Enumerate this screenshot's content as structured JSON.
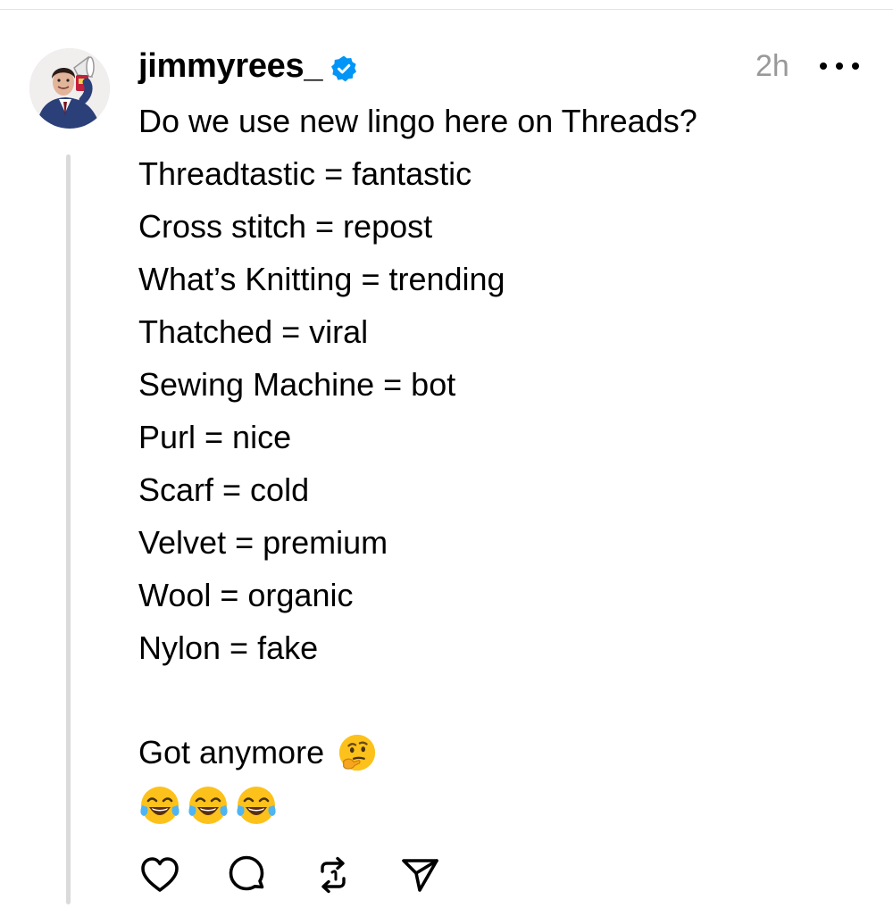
{
  "post": {
    "username": "jimmyrees_",
    "verified": true,
    "timestamp": "2h",
    "lines": [
      "Do we use new lingo here on Threads?",
      "Threadtastic = fantastic",
      "Cross stitch = repost",
      "What’s Knitting = trending",
      "Thatched = viral",
      "Sewing Machine = bot",
      "Purl = nice",
      "Scarf = cold",
      "Velvet = premium",
      "Wool = organic",
      "Nylon = fake"
    ],
    "closing_text": "Got anymore",
    "closing_emoji": "thinking-face-emoji",
    "reaction_emojis": [
      "face-with-tears-of-joy-emoji",
      "face-with-tears-of-joy-emoji",
      "face-with-tears-of-joy-emoji"
    ]
  },
  "actions": [
    {
      "name": "like",
      "icon": "heart-icon"
    },
    {
      "name": "reply",
      "icon": "comment-icon"
    },
    {
      "name": "repost",
      "icon": "repost-icon"
    },
    {
      "name": "share",
      "icon": "send-icon"
    }
  ],
  "colors": {
    "verified": "#0095f6",
    "timestamp": "#999999",
    "thread_line": "#dadada"
  }
}
